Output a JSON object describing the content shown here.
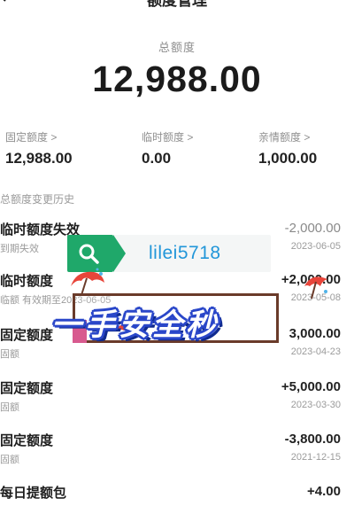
{
  "nav": {
    "title": "额度管理"
  },
  "total": {
    "label": "总额度",
    "amount": "12,988.00"
  },
  "quotas": [
    {
      "label": "固定额度 >",
      "value": "12,988.00"
    },
    {
      "label": "临时额度 >",
      "value": "0.00"
    },
    {
      "label": "亲情额度 >",
      "value": "1,000.00"
    }
  ],
  "history": {
    "title": "总额度变更历史",
    "records": [
      {
        "title": "临时额度失效",
        "subtitle": "到期失效",
        "amount": "-2,000.00",
        "date": "2023-06-05"
      },
      {
        "title": "临时额度",
        "subtitle": "临额 有效期至2023-06-05",
        "amount": "+2,000.00",
        "date": "2023-05-08"
      },
      {
        "title": "固定额度",
        "subtitle": "固额",
        "amount": "3,000.00",
        "date": "2023-04-23"
      },
      {
        "title": "固定额度",
        "subtitle": "固额",
        "amount": "+5,000.00",
        "date": "2023-03-30"
      },
      {
        "title": "固定额度",
        "subtitle": "固额",
        "amount": "-3,800.00",
        "date": "2021-12-15"
      },
      {
        "title": "每日提额包",
        "subtitle": "",
        "amount": "+4.00",
        "date": ""
      }
    ]
  },
  "watermark": {
    "search_text": "lilei5718",
    "slogan": "一手安全秒"
  },
  "colors": {
    "watermark_green": "#1fa86a",
    "watermark_blue_text": "#2196d9",
    "slogan_outline": "#2a47c9"
  },
  "icons": {
    "back": "chevron-left-icon",
    "quota_arrow": "chevron-right-icon",
    "watermark_search": "search-icon",
    "watermark_umbrella": "umbrella-icon"
  }
}
